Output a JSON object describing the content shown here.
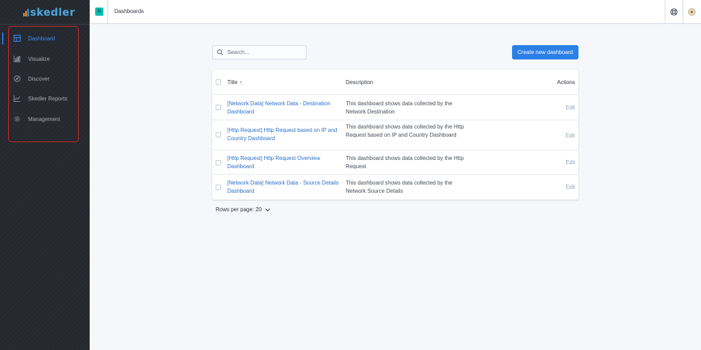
{
  "app": {
    "logo_text": "skedler"
  },
  "sidebar": {
    "items": [
      {
        "label": "Dashboard",
        "icon": "dashboard-icon",
        "active": true
      },
      {
        "label": "Visualize",
        "icon": "visualize-icon",
        "active": false
      },
      {
        "label": "Discover",
        "icon": "compass-icon",
        "active": false
      },
      {
        "label": "Skedler Reports",
        "icon": "line-chart-icon",
        "active": false
      },
      {
        "label": "Management",
        "icon": "gear-icon",
        "active": false
      }
    ]
  },
  "header": {
    "space_badge": "D",
    "breadcrumb": "Dashboards"
  },
  "main": {
    "search": {
      "placeholder": "Search..."
    },
    "create_button": "Create new dashboard",
    "table": {
      "columns": {
        "title": "Title",
        "description": "Description",
        "actions": "Actions"
      },
      "sort_indicator": "↑",
      "rows": [
        {
          "title": "[Network Data] Network Data - Destination Dashboard",
          "description": "This dashboard shows data collected by the Network Destination",
          "action": "Edit"
        },
        {
          "title": "[Http Request] Http Request based on IP and Country Dashboard",
          "description": "This dashboard shows data collected by the Http Request based on IP and Country Dashboard",
          "action": "Edit"
        },
        {
          "title": "[Http Request] Http Request Overview Dashboard",
          "description": "This dashboard shows data collected by the Http Request",
          "action": "Edit"
        },
        {
          "title": "[Network Data] Network Data - Source Details Dashboard",
          "description": "This dashboard shows data collected by the Network Source Details",
          "action": "Edit"
        }
      ]
    },
    "pagination": {
      "rows_per_page": "Rows per page: 20"
    }
  },
  "colors": {
    "sidebar_bg": "#25282f",
    "accent": "#2b7fe8",
    "link": "#2a6fcc",
    "highlight_border": "#d5282a",
    "space_badge": "#00bfb3"
  }
}
